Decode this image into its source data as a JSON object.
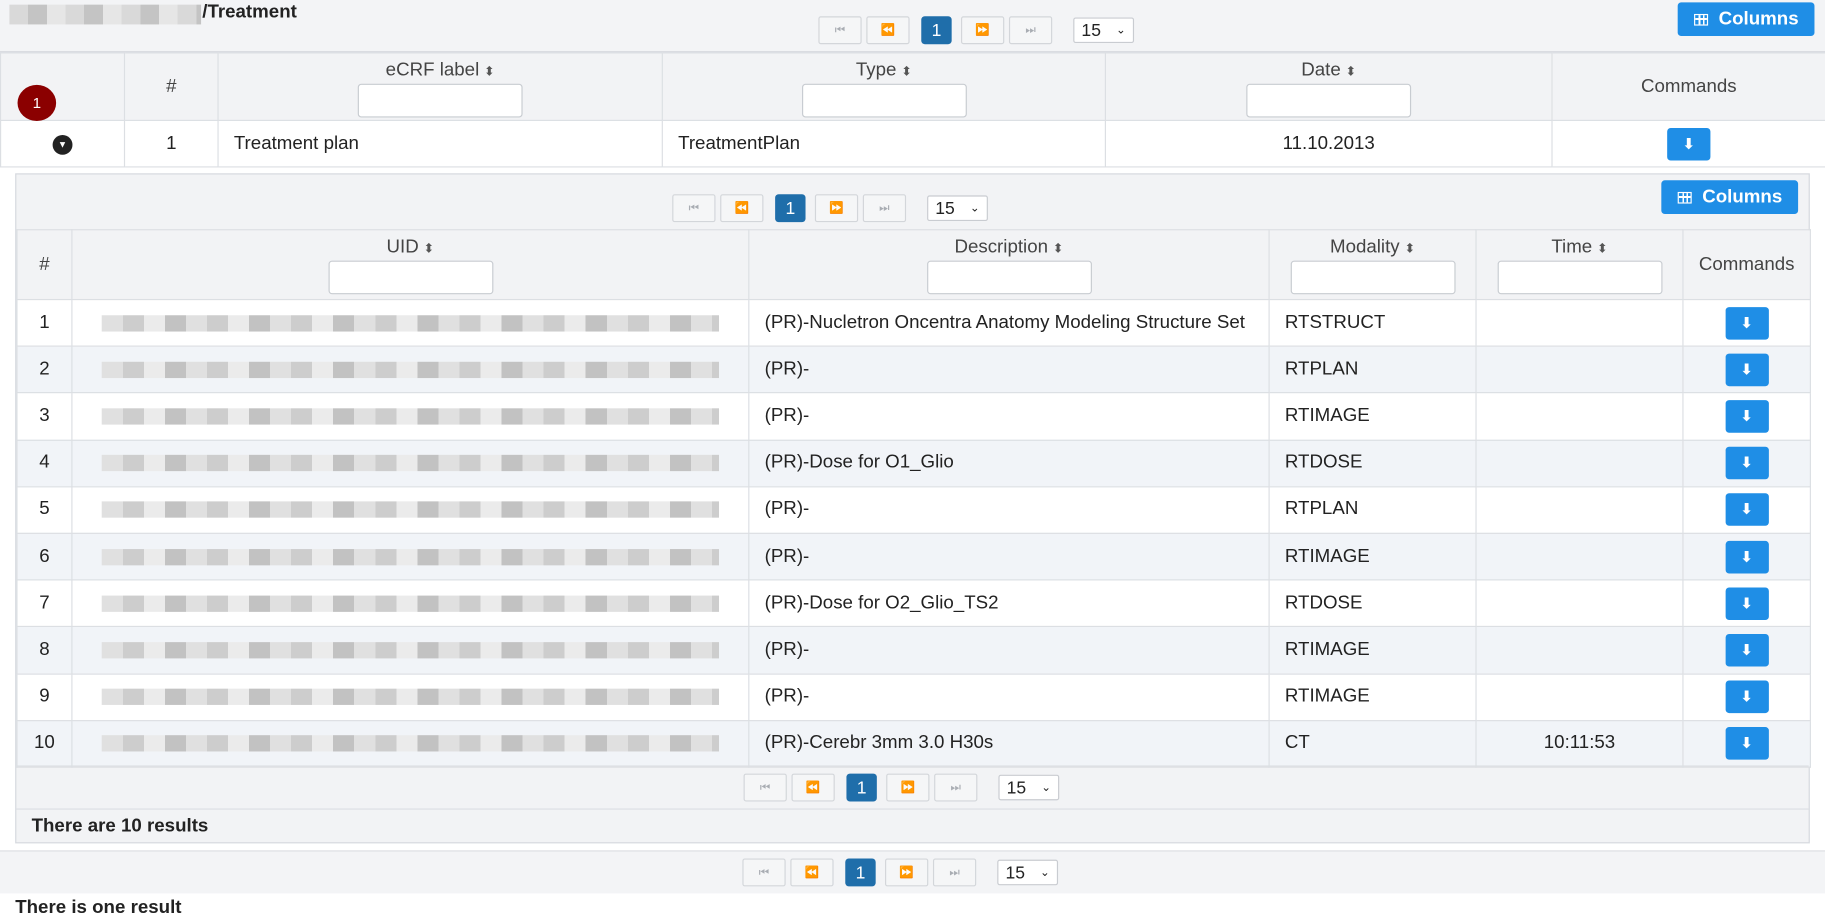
{
  "header": {
    "title_suffix": "/Treatment"
  },
  "pager": {
    "current_page": "1",
    "page_size": "15",
    "first": "⏮",
    "prev": "⏪",
    "next": "⏩",
    "last": "⏭"
  },
  "columns_button": {
    "label": "Columns"
  },
  "outer_table": {
    "badge_count": "1",
    "headers": {
      "num": "#",
      "ecrf_label": "eCRF label",
      "type": "Type",
      "date": "Date",
      "commands": "Commands"
    },
    "rows": [
      {
        "num": "1",
        "ecrf_label": "Treatment plan",
        "type": "TreatmentPlan",
        "date": "11.10.2013"
      }
    ],
    "result_text": "There is one result"
  },
  "inner_table": {
    "headers": {
      "num": "#",
      "uid": "UID",
      "description": "Description",
      "modality": "Modality",
      "time": "Time",
      "commands": "Commands"
    },
    "rows": [
      {
        "num": "1",
        "description": "(PR)-Nucletron Oncentra Anatomy Modeling Structure Set",
        "modality": "RTSTRUCT",
        "time": ""
      },
      {
        "num": "2",
        "description": "(PR)-",
        "modality": "RTPLAN",
        "time": ""
      },
      {
        "num": "3",
        "description": "(PR)-",
        "modality": "RTIMAGE",
        "time": ""
      },
      {
        "num": "4",
        "description": "(PR)-Dose for O1_Glio",
        "modality": "RTDOSE",
        "time": ""
      },
      {
        "num": "5",
        "description": "(PR)-",
        "modality": "RTPLAN",
        "time": ""
      },
      {
        "num": "6",
        "description": "(PR)-",
        "modality": "RTIMAGE",
        "time": ""
      },
      {
        "num": "7",
        "description": "(PR)-Dose for O2_Glio_TS2",
        "modality": "RTDOSE",
        "time": ""
      },
      {
        "num": "8",
        "description": "(PR)-",
        "modality": "RTIMAGE",
        "time": ""
      },
      {
        "num": "9",
        "description": "(PR)-",
        "modality": "RTIMAGE",
        "time": ""
      },
      {
        "num": "10",
        "description": "(PR)-Cerebr 3mm 3.0 H30s",
        "modality": "CT",
        "time": "10:11:53"
      }
    ],
    "result_text": "There are 10 results"
  },
  "icons": {
    "download": "download-icon",
    "columns": "grid-icon",
    "sort": "sort-icon",
    "expand": "chevron-down-icon"
  },
  "colors": {
    "primary": "#1f8ee6",
    "current_page": "#1f6eaa",
    "badge": "#8b0000"
  }
}
